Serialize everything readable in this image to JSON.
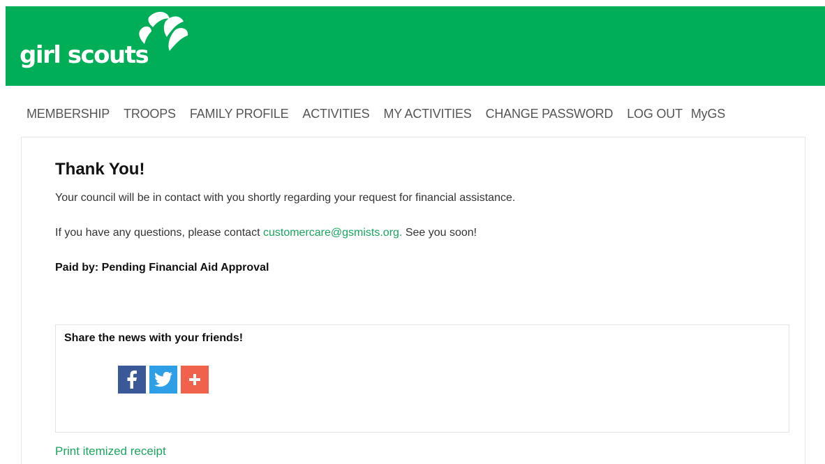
{
  "header": {
    "logo_text": "girl scouts",
    "brand_color": "#00ae58"
  },
  "nav": {
    "items": [
      "MEMBERSHIP",
      "TROOPS",
      "FAMILY PROFILE",
      "ACTIVITIES",
      "MY ACTIVITIES",
      "CHANGE PASSWORD",
      "LOG OUT",
      "MyGS"
    ]
  },
  "main": {
    "title": "Thank You!",
    "message": "Your council will be in contact with you shortly regarding your request for financial assistance.",
    "contact_prefix": "If you have any questions, please contact ",
    "contact_email": "customercare@gsmists.org.",
    "contact_suffix": " See you soon!",
    "paid_by": "Paid by: Pending Financial Aid Approval"
  },
  "share": {
    "title": "Share the news with your friends!",
    "buttons": [
      {
        "icon": "facebook-icon",
        "color": "#3b5998"
      },
      {
        "icon": "twitter-icon",
        "color": "#2e9ee6"
      },
      {
        "icon": "plus-icon",
        "color": "#f0624c"
      }
    ]
  },
  "footer": {
    "receipt_link": "Print itemized receipt"
  },
  "colors": {
    "link_green": "#1aa55e"
  }
}
